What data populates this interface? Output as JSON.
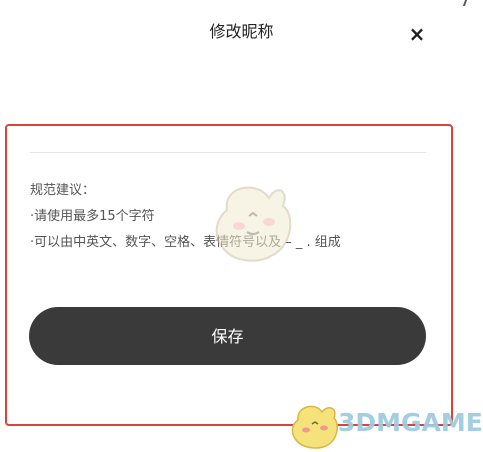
{
  "header": {
    "title": "修改昵称",
    "close_icon": "close-icon",
    "close_glyph": "×"
  },
  "form": {
    "nickname_value": "",
    "rules": [
      "规范建议：",
      "·请使用最多15个字符",
      "·可以由中英文、数字、空格、表情符号以及 – _ . 组成"
    ],
    "save_label": "保存"
  },
  "watermark": {
    "text": "3DMGAME"
  },
  "colors": {
    "highlight_border": "#d9433b",
    "button_bg": "#3a3a3a",
    "button_text": "#ffffff",
    "watermark_text": "#9fcbe0"
  }
}
